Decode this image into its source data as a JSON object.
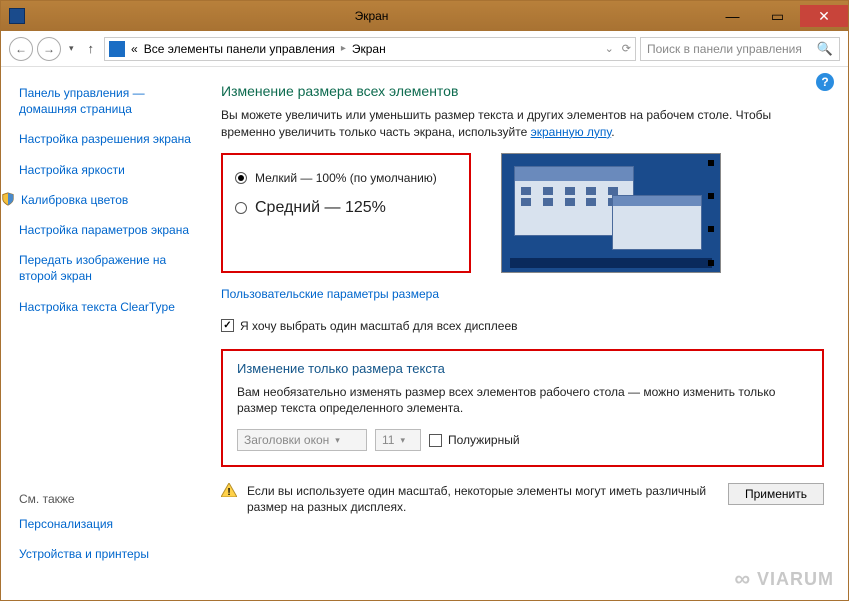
{
  "titlebar": {
    "title": "Экран"
  },
  "navbar": {
    "breadcrumb_prefix": "«",
    "breadcrumb1": "Все элементы панели управления",
    "breadcrumb2": "Экран",
    "search_placeholder": "Поиск в панели управления"
  },
  "sidebar": {
    "items": [
      "Панель управления — домашняя страница",
      "Настройка разрешения экрана",
      "Настройка яркости",
      "Калибровка цветов",
      "Настройка параметров экрана",
      "Передать изображение на второй экран",
      "Настройка текста ClearType"
    ],
    "footer_header": "См. также",
    "footer_items": [
      "Персонализация",
      "Устройства и принтеры"
    ]
  },
  "main": {
    "h1": "Изменение размера всех элементов",
    "desc_before": "Вы можете увеличить или уменьшить размер текста и других элементов на рабочем столе. Чтобы временно увеличить только часть экрана, используйте ",
    "desc_link": "экранную лупу",
    "desc_after": ".",
    "radio_small": "Мелкий — 100% (по умолчанию)",
    "radio_medium": "Средний — 125%",
    "custom_link": "Пользовательские параметры размера",
    "checkbox_label": "Я хочу выбрать один масштаб для всех дисплеев",
    "h2": "Изменение только размера текста",
    "desc2": "Вам необязательно изменять размер всех элементов рабочего стола — можно изменить только размер текста определенного элемента.",
    "combo_target": "Заголовки окон",
    "combo_size": "11",
    "bold_label": "Полужирный",
    "warning": "Если вы используете один масштаб, некоторые элементы могут иметь различный размер на разных дисплеях.",
    "apply": "Применить"
  },
  "watermark": "VIARUM"
}
